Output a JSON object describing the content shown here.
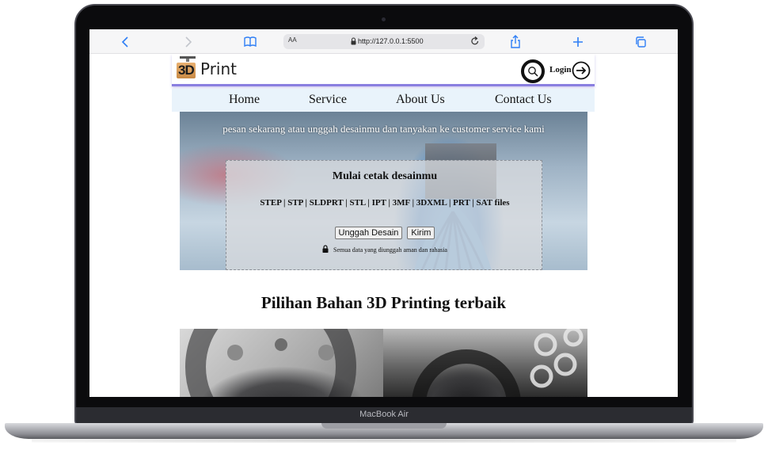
{
  "device": {
    "label": "MacBook Air"
  },
  "browser": {
    "url": "http://127.0.0.1:5500",
    "text_size": "AA"
  },
  "site": {
    "logo_3d": "3D",
    "logo_print": "Print",
    "login_label": "Login",
    "nav": [
      "Home",
      "Service",
      "About Us",
      "Contact Us"
    ]
  },
  "hero": {
    "tagline": "pesan sekarang atau unggah desainmu dan tanyakan ke customer service kami",
    "upload_title": "Mulai cetak desainmu",
    "formats": "STEP | STP | SLDPRT | STL | IPT | 3MF | 3DXML | PRT | SAT files",
    "upload_button": "Unggah Desain",
    "submit_button": "Kirim",
    "secure_note": "Semua data yang diunggah aman dan rahasia"
  },
  "materials": {
    "title": "Pilihan Bahan 3D Printing terbaik"
  },
  "colors": {
    "accent": "#2f7ff5",
    "header_border": "#8a7fe0",
    "nav_bg": "#e9f3fb"
  }
}
